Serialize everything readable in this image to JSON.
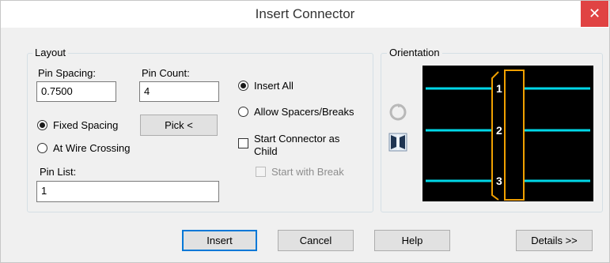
{
  "window": {
    "title": "Insert Connector",
    "close_glyph": "✕"
  },
  "layout": {
    "legend": "Layout",
    "pin_spacing_label": "Pin Spacing:",
    "pin_spacing_value": "0.7500",
    "pin_count_label": "Pin Count:",
    "pin_count_value": "4",
    "fixed_spacing_label": "Fixed Spacing",
    "fixed_spacing_checked": true,
    "at_wire_crossing_label": "At Wire Crossing",
    "pick_label": "Pick <",
    "pin_list_label": "Pin List:",
    "pin_list_value": "1",
    "insert_all_label": "Insert All",
    "insert_all_checked": true,
    "allow_spacers_label": "Allow Spacers/Breaks",
    "start_child_label_1": "Start Connector as",
    "start_child_label_2": "Child",
    "start_break_label": "Start with Break"
  },
  "orientation": {
    "legend": "Orientation",
    "rotate_icon": "rotate-icon",
    "flip_icon": "flip-icon",
    "pins": [
      "1",
      "2",
      "3"
    ],
    "colors": {
      "wire": "#00d8e8",
      "connector": "#f0a000",
      "pin_text": "#ffffff",
      "background": "#000000"
    }
  },
  "buttons": {
    "insert": "Insert",
    "cancel": "Cancel",
    "help": "Help",
    "details": "Details >>"
  }
}
